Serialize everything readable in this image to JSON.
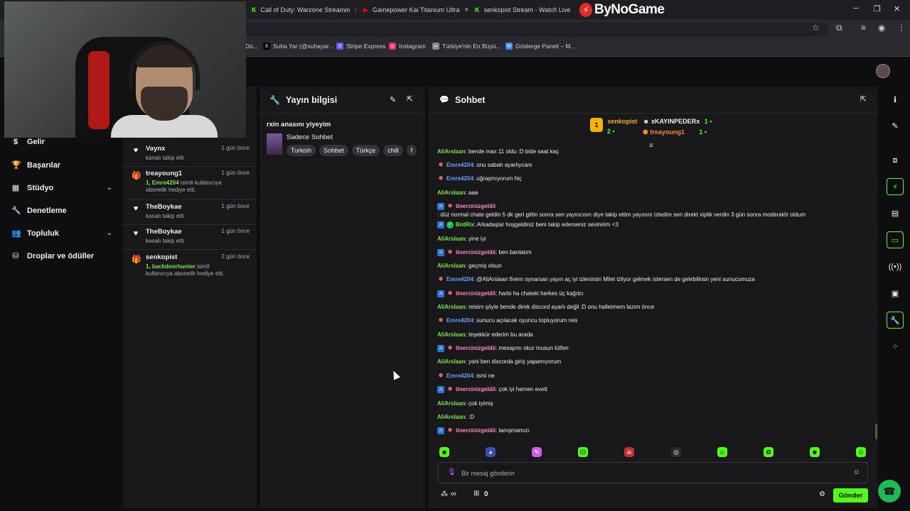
{
  "browser": {
    "tabs": [
      {
        "label": "Call of Duty: Warzone Streamin",
        "fav": "K",
        "color": "#53fc18"
      },
      {
        "label": "Gamepower Kai Titanium Ultra",
        "fav": "▶",
        "color": "#ff0000"
      },
      {
        "label": "senkopist Stream - Watch Live",
        "fav": "K",
        "color": "#53fc18"
      }
    ],
    "brand": "ByNoGame",
    "bookmarks": [
      {
        "label": "Dü...",
        "color": "#666"
      },
      {
        "label": "Suha Yar (@suhayar...",
        "color": "#000"
      },
      {
        "label": "Stripe Express",
        "color": "#635bff"
      },
      {
        "label": "Instagram",
        "color": "#e1306c"
      },
      {
        "label": "Türkiye'nin En Büyü...",
        "color": "#888"
      },
      {
        "label": "Gösterge Paneli – M...",
        "color": "#3b82f6"
      }
    ]
  },
  "leftnav": {
    "items": [
      {
        "label": "Gelir",
        "icon": "$",
        "chev": false
      },
      {
        "label": "Başarılar",
        "icon": "🏆",
        "chev": false
      },
      {
        "label": "Stüdyo",
        "icon": "▦",
        "chev": true
      },
      {
        "label": "Denetleme",
        "icon": "🔧",
        "chev": false
      },
      {
        "label": "Topluluk",
        "icon": "👥",
        "chev": true
      },
      {
        "label": "Droplar ve ödüller",
        "icon": "⛁",
        "chev": false
      }
    ]
  },
  "activity": [
    {
      "name": "Vaynx",
      "time": "1 gün önce",
      "desc": "kanalı takip etti",
      "hl": "",
      "icon": "heart"
    },
    {
      "name": "treayoung1",
      "time": "1 gün önce",
      "hl": "1, Emre4204",
      "desc": " isimli kullanıcıya abonelik hediye etti.",
      "icon": "gift"
    },
    {
      "name": "TheBoykae",
      "time": "1 gün önce",
      "desc": "kanalı takip etti",
      "hl": "",
      "icon": "heart"
    },
    {
      "name": "TheBoykae",
      "time": "1 gün önce",
      "desc": "kanalı takip etti",
      "hl": "",
      "icon": "heart"
    },
    {
      "name": "senkopist",
      "time": "2 gün önce",
      "hl": "1, backdoorhunter",
      "desc": " isimli kullanıcıya abonelik hediye etti.",
      "icon": "gift"
    }
  ],
  "streaminfo": {
    "panel_title": "Yayın bilgisi",
    "title": "rxin anasını yiyeyim",
    "category": "Sadece Sohbet",
    "tags": [
      "Turkish",
      "Sohbet",
      "Türkçe",
      "chill",
      "f"
    ]
  },
  "chat": {
    "panel_title": "Sohbet",
    "leaders": [
      {
        "name": "senkopist",
        "count": "2",
        "rank": "1"
      },
      {
        "name": "xKAYINPEDERx",
        "count": "1"
      },
      {
        "name": "treayoung1",
        "count": "1"
      }
    ],
    "messages": [
      {
        "badges": [],
        "user": "AliArslaan",
        "color": "green",
        "text": ": bende max 11 oldu :D bide saat kaç"
      },
      {
        "badges": [
          "sub"
        ],
        "user": "Emre4204",
        "color": "blue",
        "text": ": onu sabah ayarlıycam"
      },
      {
        "badges": [
          "sub"
        ],
        "user": "Emre4204",
        "color": "blue",
        "text": ": uğraşmıyorum hiç"
      },
      {
        "badges": [],
        "user": "AliArslaan",
        "color": "green",
        "text": ": aaa"
      },
      {
        "badges": [
          "mod",
          "sub"
        ],
        "user": "tinercinizgeldii",
        "color": "pink",
        "text": ": düz normal chate geldin 5 dk geri gittin sonra sen yayıncısın diye takip ettim yayınını izledim sen direkt viplik verdin 3 gün sonra moderatör oldum"
      },
      {
        "badges": [
          "mod",
          "vip"
        ],
        "user": "BotRix",
        "color": "lime",
        "text": ": Arkadaşlar hoşgeldiniz beni takip ederseniz sevinirim <3"
      },
      {
        "badges": [],
        "user": "AliArslaan",
        "color": "green",
        "text": ": yine iyi"
      },
      {
        "badges": [
          "mod",
          "sub"
        ],
        "user": "tinercinizgeldii",
        "color": "pink",
        "text": ": ben banlatım"
      },
      {
        "badges": [],
        "user": "AliArslaan",
        "color": "green",
        "text": ": geçmiş olsun"
      },
      {
        "badges": [
          "sub"
        ],
        "user": "Emre4204",
        "color": "blue",
        "text": ": @AliArslaan fivem oynarsan yayın aç iyi izlenirsin Milet izliyor gelmek istersen de gelebilirsin yeni sunucumuza"
      },
      {
        "badges": [
          "mod",
          "sub"
        ],
        "user": "tinercinizgeldii",
        "color": "pink",
        "text": ": harbi ha chateki herkes üç kağıtcı"
      },
      {
        "badges": [],
        "user": "AliArslaan",
        "color": "green",
        "text": ": reisim şöyle bende direk discord ayarlı değil :D onu halletmem lazım önce"
      },
      {
        "badges": [
          "sub"
        ],
        "user": "Emre4204",
        "color": "blue",
        "text": ": sunucu açılacak oyuncu topluyorum reis"
      },
      {
        "badges": [],
        "user": "AliArslaan",
        "color": "green",
        "text": ": teşekkür ederim bu arada"
      },
      {
        "badges": [
          "mod",
          "sub"
        ],
        "user": "tinercinizgeldii",
        "color": "pink",
        "text": ": mesajımı okur musun lütfen"
      },
      {
        "badges": [],
        "user": "AliArslaan",
        "color": "green",
        "text": ": yani ben discorda giriş yapamıyorum"
      },
      {
        "badges": [
          "sub"
        ],
        "user": "Emre4204",
        "color": "blue",
        "text": ": ismi ne"
      },
      {
        "badges": [
          "mod",
          "sub"
        ],
        "user": "tinercinizgeldii",
        "color": "pink",
        "text": ": çok iyi hemen evett"
      },
      {
        "badges": [],
        "user": "AliArslaan",
        "color": "green",
        "text": ": çok iyimiş"
      },
      {
        "badges": [],
        "user": "AliArslaan",
        "color": "green",
        "text": ": :D"
      },
      {
        "badges": [
          "mod",
          "sub"
        ],
        "user": "tinercinizgeldii",
        "color": "pink",
        "text": ": tanışmamızı"
      }
    ],
    "input_placeholder": "Bir mesaj gönderin",
    "send_label": "Gönder",
    "infinity": "∞",
    "count": "0"
  }
}
